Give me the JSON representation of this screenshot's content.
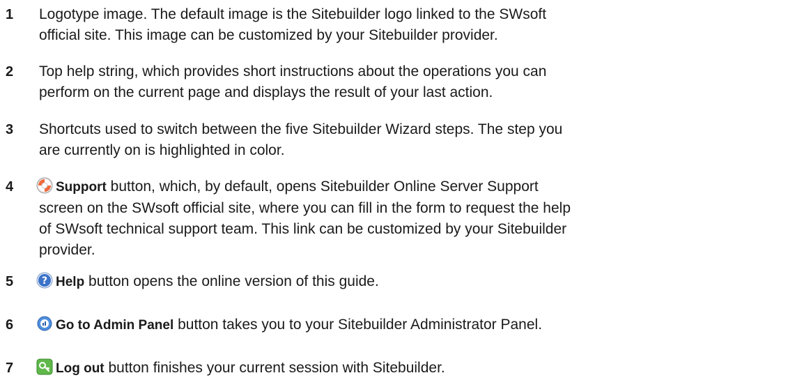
{
  "items": [
    {
      "number": "1",
      "text_line1": "Logotype image. The default image is the Sitebuilder logo linked to the SWsoft",
      "text_rest": "official site. This image can be customized by your Sitebuilder provider."
    },
    {
      "number": "2",
      "text_line1": "Top help string, which provides short instructions about the operations you can",
      "text_rest": "perform on the current page and displays the result of your last action."
    },
    {
      "number": "3",
      "text_line1": "Shortcuts used to switch between the five Sitebuilder Wizard steps. The step you",
      "text_rest": "are currently on is highlighted in color."
    },
    {
      "number": "4",
      "icon": "support-lifebuoy-icon",
      "label": "Support",
      "text_line1": " button, which, by default, opens Sitebuilder Online Server Support",
      "text_line2": "screen on the SWsoft official site, where you can fill in the form to request the help",
      "text_line3": "of SWsoft technical support team. This link can be customized by your Sitebuilder",
      "text_line4": "provider."
    },
    {
      "number": "5",
      "icon": "help-question-icon",
      "label": "Help",
      "text_line1": " button opens the online version of this guide."
    },
    {
      "number": "6",
      "icon": "admin-panel-icon",
      "label": "Go to Admin Panel",
      "text_line1": " button takes you to your Sitebuilder Administrator Panel."
    },
    {
      "number": "7",
      "icon": "logout-key-icon",
      "label": "Log out",
      "text_line1": " button finishes your current session with Sitebuilder."
    }
  ]
}
